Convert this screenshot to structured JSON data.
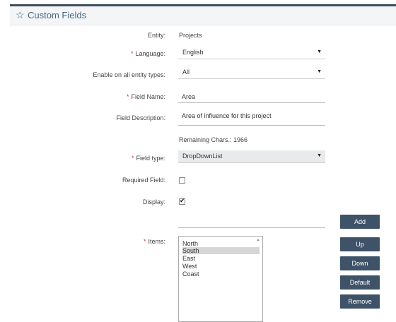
{
  "header": {
    "title": "Custom Fields",
    "icon": "star-outline"
  },
  "form": {
    "entity": {
      "label": "Entity:",
      "value": "Projects"
    },
    "language": {
      "label": "Language:",
      "value": "English"
    },
    "enable_all": {
      "label": "Enable on all entity types:",
      "value": "All"
    },
    "field_name": {
      "label": "Field Name:",
      "value": "Area"
    },
    "field_description": {
      "label": "Field Description:",
      "value": "Area of influence for this project"
    },
    "remaining": "Remaining Chars.: 1966",
    "field_type": {
      "label": "Field type:",
      "value": "DropDownList"
    },
    "required_field": {
      "label": "Required Field:",
      "checked": false
    },
    "display": {
      "label": "Display:",
      "checked": true
    },
    "items": {
      "label": "Items:",
      "list": [
        "North",
        "South",
        "East",
        "West",
        "Coast"
      ],
      "selected": "South"
    }
  },
  "buttons": {
    "add": "Add",
    "up": "Up",
    "down": "Down",
    "default": "Default",
    "remove": "Remove"
  },
  "required_marker": "*",
  "check_glyph": "✔",
  "caret_glyph": "▼",
  "star_glyph": "☆",
  "scroll_glyph": "▲",
  "colors": {
    "accent": "#3e5268",
    "required": "#d63a3a",
    "title": "#4a6580"
  }
}
